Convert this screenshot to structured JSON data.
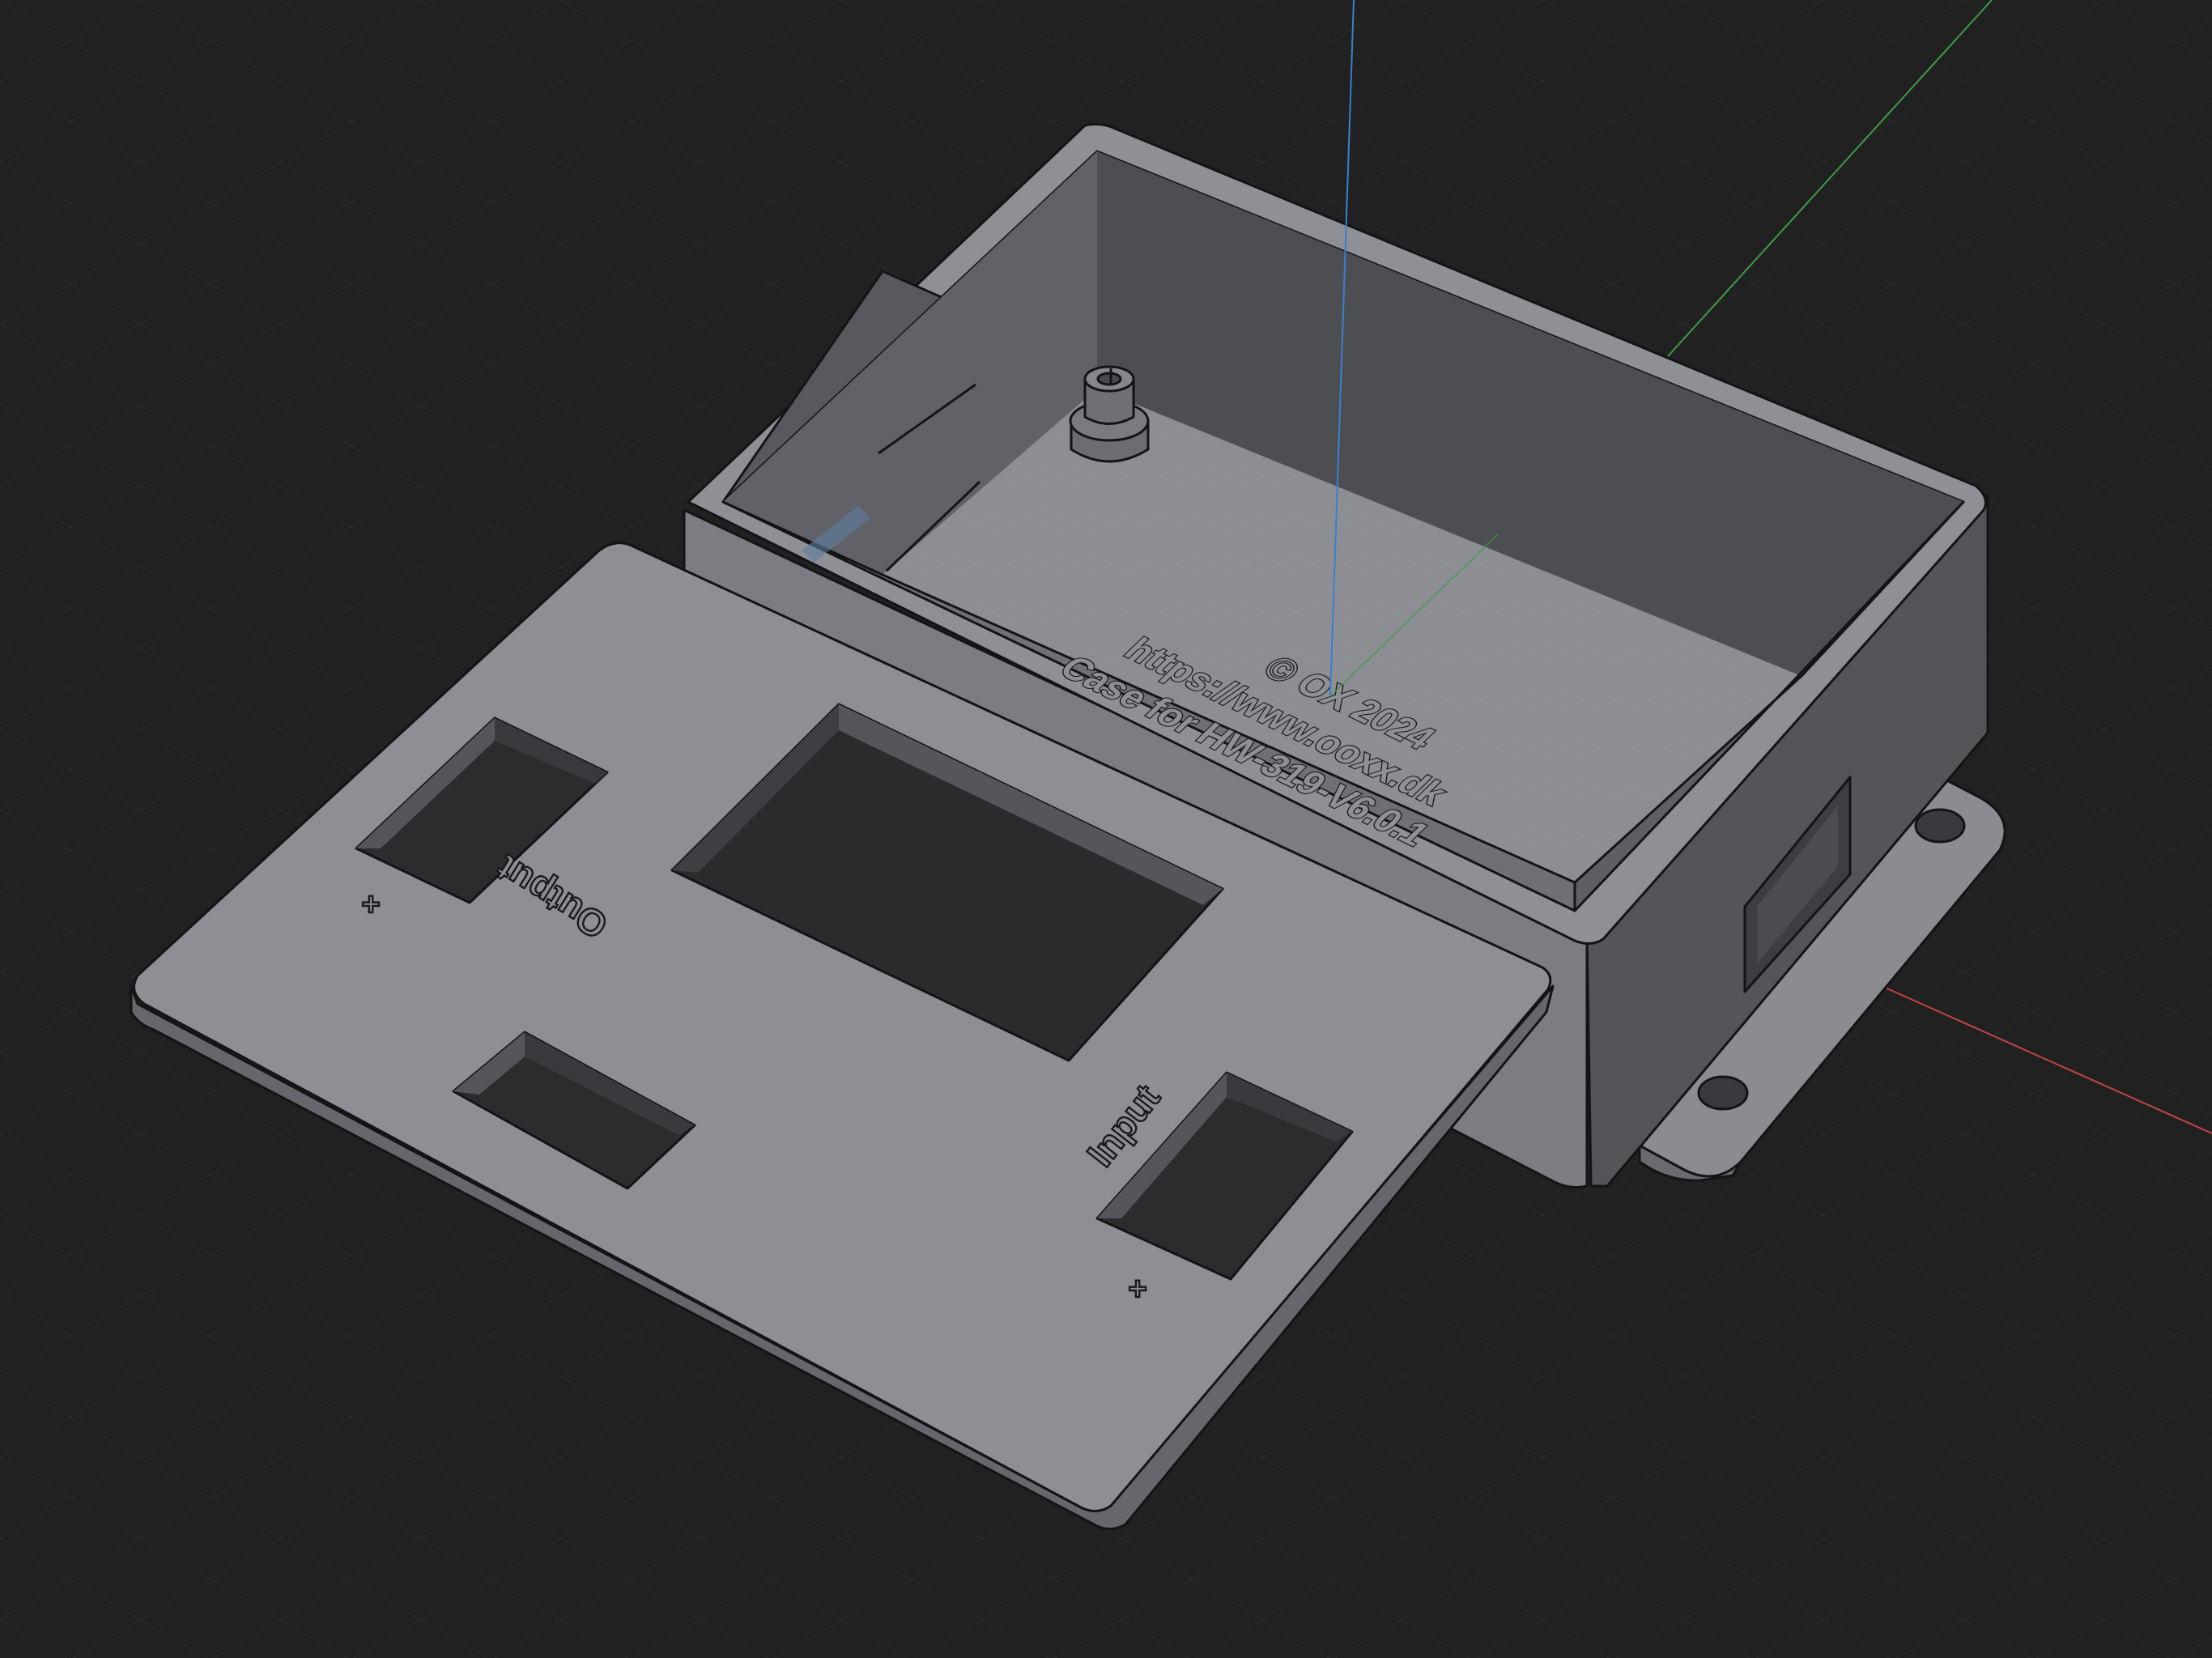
{
  "viewport": {
    "background": "#212121",
    "grid_color": "#2c2c2c",
    "axes": {
      "x_color": "#c24545",
      "y_color": "#3d9c46",
      "z_color": "#3a7fd0"
    }
  },
  "model": {
    "case_body_color": "#8a8b90",
    "case_inner_color": "#595a5f",
    "lid_color": "#8e8f95",
    "case_text": {
      "line1": "© OX 2024",
      "line2": "https://www.ooxx.dk",
      "line3": "Case for HW-319-V6.0.1"
    },
    "lid_labels": {
      "output": "Output",
      "input": "Input",
      "output_polarity": "+",
      "input_polarity": "+"
    }
  }
}
